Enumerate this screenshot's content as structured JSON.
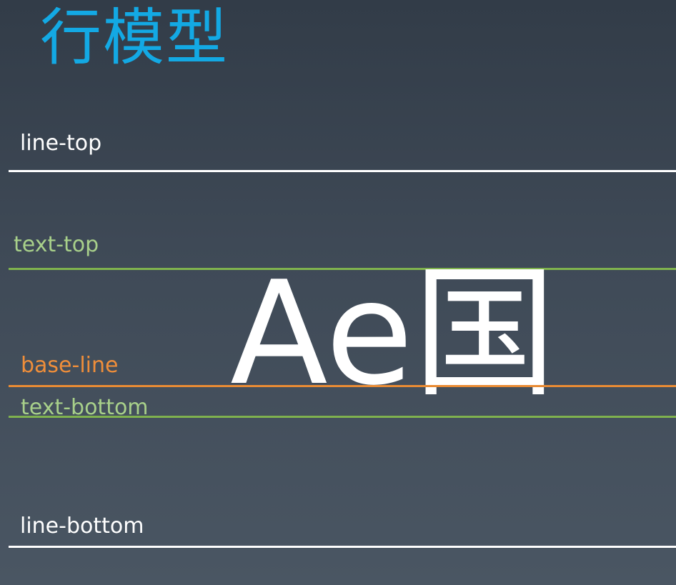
{
  "title": "行模型",
  "sample_text": "Ae国",
  "lines": [
    {
      "key": "line_top",
      "label": "line-top",
      "color": "#ffffff"
    },
    {
      "key": "text_top",
      "label": "text-top",
      "color": "#7fb24e"
    },
    {
      "key": "base_line",
      "label": "base-line",
      "color": "#e98b34"
    },
    {
      "key": "text_bottom",
      "label": "text-bottom",
      "color": "#7fb24e"
    },
    {
      "key": "line_bottom",
      "label": "line-bottom",
      "color": "#ffffff"
    }
  ]
}
